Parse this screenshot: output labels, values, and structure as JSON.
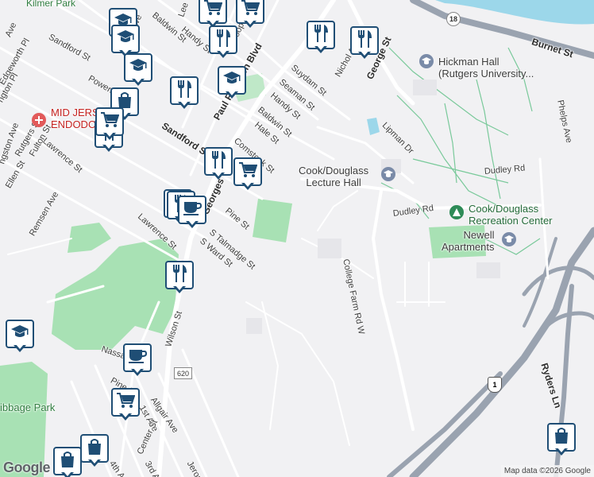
{
  "map": {
    "attribution": "Map data ©2026 Google",
    "logo": "Google",
    "streets": [
      {
        "text": "Kilmer Park",
        "cls": "park"
      },
      {
        "text": "Sandford St"
      },
      {
        "text": "Baldwin St"
      },
      {
        "text": "Lee"
      },
      {
        "text": "Handy St"
      },
      {
        "text": "Throop Ave"
      },
      {
        "text": "Paul Robeson Blvd",
        "cls": "bold"
      },
      {
        "text": "George St",
        "cls": "bold"
      },
      {
        "text": "Suydam St"
      },
      {
        "text": "Seaman St"
      },
      {
        "text": "Handy St"
      },
      {
        "text": "Baldwin St"
      },
      {
        "text": "Hale St"
      },
      {
        "text": "Comstock St"
      },
      {
        "text": "Sandford St",
        "cls": "bold"
      },
      {
        "text": "Nichol Ave"
      },
      {
        "text": "Burnet St",
        "cls": "bold"
      },
      {
        "text": "Lipman Dr"
      },
      {
        "text": "Dudley Rd"
      },
      {
        "text": "Dudley Rd"
      },
      {
        "text": "College Farm Rd W"
      },
      {
        "text": "Pine St"
      },
      {
        "text": "S Talmadge St"
      },
      {
        "text": "S Ward St"
      },
      {
        "text": "Lawrence St"
      },
      {
        "text": "Remsen Ave"
      },
      {
        "text": "Lawrence St"
      },
      {
        "text": "Rutgers St"
      },
      {
        "text": "Fulton St"
      },
      {
        "text": "Ellen St"
      },
      {
        "text": "Edgeworth Pl"
      },
      {
        "text": "Powers"
      },
      {
        "text": "Wilson St"
      },
      {
        "text": "Nassau"
      },
      {
        "text": "Pine St"
      },
      {
        "text": "Allgair Ave"
      },
      {
        "text": "1st Ave"
      },
      {
        "text": "4th Ave"
      },
      {
        "text": "Center St"
      },
      {
        "text": "3rd Ave"
      },
      {
        "text": "Jerome St"
      },
      {
        "text": "Ryders Ln",
        "cls": "bold"
      },
      {
        "text": "Phelps Ave"
      },
      {
        "text": "Georges",
        "cls": "bold"
      },
      {
        "text": "Ave"
      },
      {
        "text": "Ave"
      },
      {
        "text": "ngton Pl"
      },
      {
        "text": "ngston Ave"
      }
    ],
    "places": [
      {
        "text": "Hickman Hall\n(Rutgers University...",
        "icon": "education"
      },
      {
        "text": "Cook/Douglass\nLecture Hall",
        "icon": "education"
      },
      {
        "text": "Cook/Douglass\nRecreation Center",
        "icon": "recreation"
      },
      {
        "text": "Newell\nApartments",
        "icon": "education"
      },
      {
        "text": "MID JERS\nENDODO",
        "icon": "medical"
      },
      {
        "text": "ibbage Park",
        "icon": "none"
      }
    ],
    "pins": [
      {
        "icon": "graduation-cap"
      },
      {
        "icon": "graduation-cap"
      },
      {
        "icon": "shopping-cart"
      },
      {
        "icon": "shopping-cart"
      },
      {
        "icon": "restaurant"
      },
      {
        "icon": "restaurant"
      },
      {
        "icon": "restaurant"
      },
      {
        "icon": "restaurant"
      },
      {
        "icon": "graduation-cap"
      },
      {
        "icon": "restaurant"
      },
      {
        "icon": "graduation-cap"
      },
      {
        "icon": "shopping-bag"
      },
      {
        "icon": "shopping-cart"
      },
      {
        "icon": "restaurant"
      },
      {
        "icon": "restaurant"
      },
      {
        "icon": "shopping-cart"
      },
      {
        "icon": "restaurant"
      },
      {
        "icon": "coffee"
      },
      {
        "icon": "restaurant"
      },
      {
        "icon": "graduation-cap"
      },
      {
        "icon": "coffee"
      },
      {
        "icon": "shopping-cart"
      },
      {
        "icon": "shopping-bag"
      },
      {
        "icon": "shopping-bag"
      },
      {
        "icon": "shopping-bag"
      }
    ],
    "route_shields": [
      {
        "text": "18",
        "kind": "circle"
      },
      {
        "text": "1",
        "kind": "us"
      },
      {
        "text": "620",
        "kind": "box"
      }
    ],
    "colors": {
      "pin_border": "#1f4e75",
      "park": "#a8e1b4",
      "water": "#9cd7ea",
      "highway": "#9aa3b0",
      "road": "#ffffff",
      "campus_path": "#79c99a",
      "land": "#f1f1f3"
    }
  }
}
